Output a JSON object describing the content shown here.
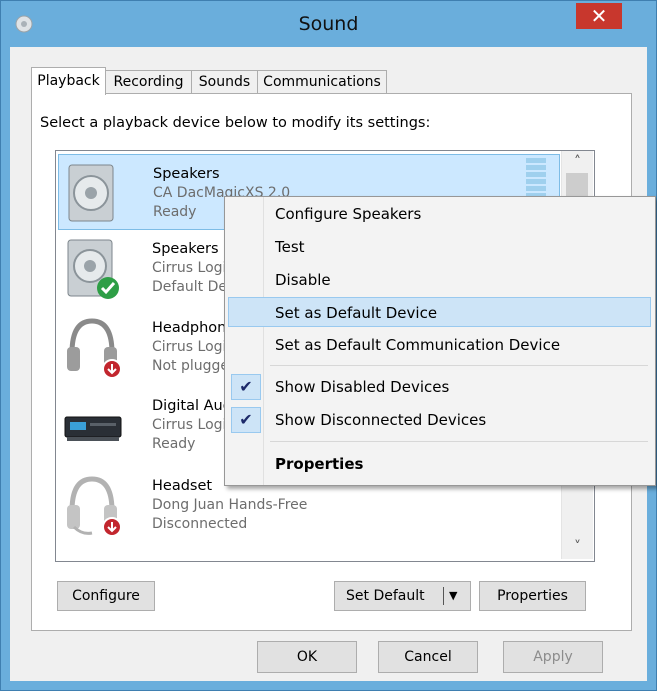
{
  "window": {
    "title": "Sound",
    "close_glyph": "✕"
  },
  "tabs": [
    {
      "label": "Playback"
    },
    {
      "label": "Recording"
    },
    {
      "label": "Sounds"
    },
    {
      "label": "Communications"
    }
  ],
  "instruction": "Select a playback device below to modify its settings:",
  "devices": [
    {
      "name": "Speakers",
      "driver": "CA DacMagicXS 2.0",
      "status": "Ready"
    },
    {
      "name": "Speakers",
      "driver": "Cirrus Logic",
      "status": "Default Device"
    },
    {
      "name": "Headphones",
      "driver": "Cirrus Logic",
      "status": "Not plugged in"
    },
    {
      "name": "Digital Audio",
      "driver": "Cirrus Logic",
      "status": "Ready"
    },
    {
      "name": "Headset",
      "driver": "Dong Juan Hands-Free",
      "status": "Disconnected"
    }
  ],
  "buttons": {
    "configure": "Configure",
    "set_default": "Set Default",
    "properties": "Properties",
    "ok": "OK",
    "cancel": "Cancel",
    "apply": "Apply"
  },
  "context_menu": {
    "configure": "Configure Speakers",
    "test": "Test",
    "disable": "Disable",
    "set_default": "Set as Default Device",
    "set_default_comm": "Set as Default Communication Device",
    "show_disabled": "Show Disabled Devices",
    "show_disconnected": "Show Disconnected Devices",
    "properties": "Properties",
    "check_glyph": "✔"
  },
  "colors": {
    "accent": "#6aaedc",
    "close": "#c8372d",
    "selected": "#cce8ff"
  }
}
